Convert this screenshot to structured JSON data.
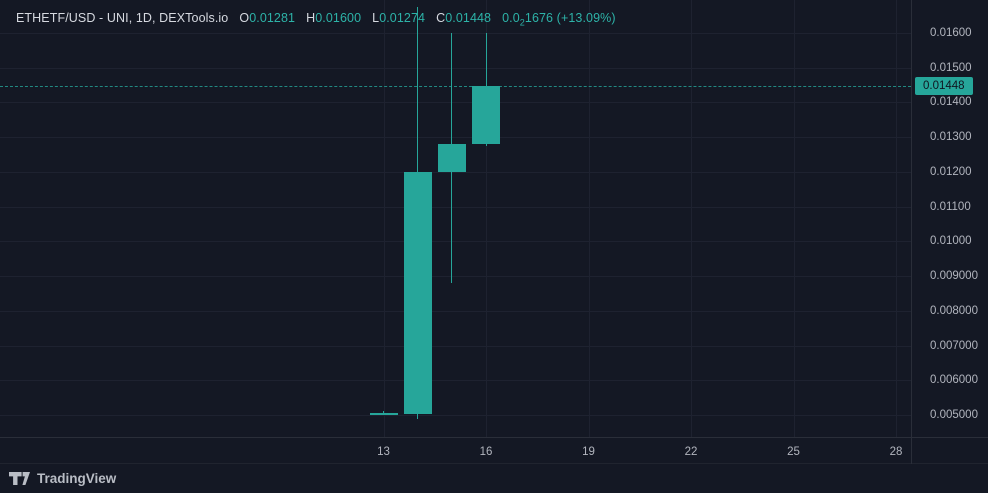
{
  "header": {
    "symbol_title": "ETHETF/USD - UNI, 1D, DEXTools.io",
    "ohlc": [
      {
        "label": "O",
        "value": "0.01281"
      },
      {
        "label": "H",
        "value": "0.01600"
      },
      {
        "label": "L",
        "value": "0.01274"
      },
      {
        "label": "C",
        "value": "0.01448"
      }
    ],
    "change_lead": "0.0",
    "change_sub": "2",
    "change_tail": "1676 (+13.09%)"
  },
  "price_axis": {
    "last_price_label": "0.01448"
  },
  "footer": {
    "brand": "TradingView"
  },
  "colors": {
    "background": "#141824",
    "grid": "#1e2230",
    "axis_border": "#2a2e39",
    "axis_text": "#b2b5be",
    "title_text": "#d6d9e0",
    "up": "#26a69a",
    "value_text": "#2db3a8",
    "badge_text": "#10141f",
    "brand_text": "#b9bdc5"
  },
  "chart_data": {
    "type": "candlestick",
    "title": "ETHETF/USD - UNI, 1D, DEXTools.io",
    "pair": "ETHETF/USD",
    "exchange": "UNI",
    "interval": "1D",
    "source": "DEXTools.io",
    "legend_ohlc": {
      "open": 0.01281,
      "high": 0.016,
      "low": 0.01274,
      "close": 0.01448
    },
    "change_abs": 0.001676,
    "change_pct": 13.09,
    "last_price": 0.01448,
    "candles": [
      {
        "day": 13,
        "o": 0.00506,
        "h": 0.00513,
        "l": 0.005,
        "c": 0.00507,
        "dir": "up"
      },
      {
        "day": 14,
        "o": 0.00503,
        "h": 0.01675,
        "l": 0.0049,
        "c": 0.012,
        "dir": "up"
      },
      {
        "day": 15,
        "o": 0.012,
        "h": 0.016,
        "l": 0.0088,
        "c": 0.0128,
        "dir": "up"
      },
      {
        "day": 16,
        "o": 0.01281,
        "h": 0.016,
        "l": 0.01274,
        "c": 0.01448,
        "dir": "up"
      }
    ],
    "x_ticks": [
      13,
      16,
      19,
      22,
      25,
      28
    ],
    "y_ticks": [
      {
        "label": "0.01600",
        "value": 0.016
      },
      {
        "label": "0.01500",
        "value": 0.015
      },
      {
        "label": "0.01400",
        "value": 0.014
      },
      {
        "label": "0.01300",
        "value": 0.013
      },
      {
        "label": "0.01200",
        "value": 0.012
      },
      {
        "label": "0.01100",
        "value": 0.011
      },
      {
        "label": "0.01000",
        "value": 0.01
      },
      {
        "label": "0.009000",
        "value": 0.009
      },
      {
        "label": "0.008000",
        "value": 0.008
      },
      {
        "label": "0.007000",
        "value": 0.007
      },
      {
        "label": "0.006000",
        "value": 0.006
      },
      {
        "label": "0.005000",
        "value": 0.005
      }
    ],
    "y_range": {
      "top": 0.01695,
      "bottom": 0.00437
    },
    "grid": true,
    "legend_position": "top-left"
  }
}
